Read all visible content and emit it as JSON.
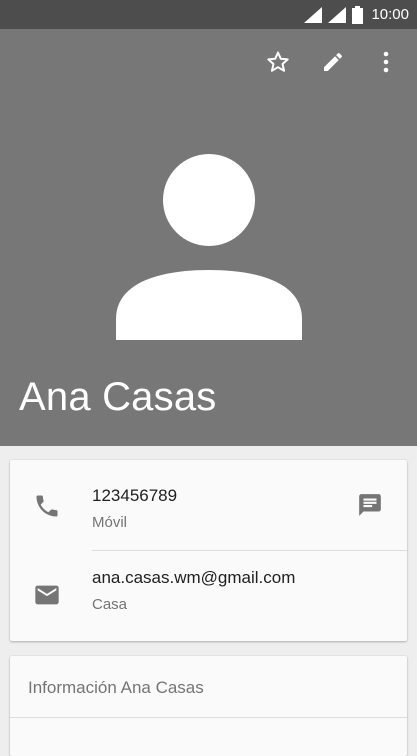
{
  "status_bar": {
    "time": "10:00",
    "icons": [
      "wifi-signal-icon",
      "cell-signal-icon",
      "battery-icon"
    ]
  },
  "header": {
    "background_color": "#777777",
    "actions": [
      {
        "name": "favorite",
        "icon": "star-outline-icon"
      },
      {
        "name": "edit",
        "icon": "pencil-icon"
      },
      {
        "name": "more",
        "icon": "more-vert-icon"
      }
    ],
    "contact_name": "Ana Casas"
  },
  "details": {
    "phone": {
      "icon": "phone-icon",
      "number": "123456789",
      "type": "Móvil",
      "action_icon": "message-icon"
    },
    "email": {
      "icon": "email-icon",
      "address": "ana.casas.wm@gmail.com",
      "type": "Casa"
    }
  },
  "info_card": {
    "title": "Información Ana Casas"
  }
}
